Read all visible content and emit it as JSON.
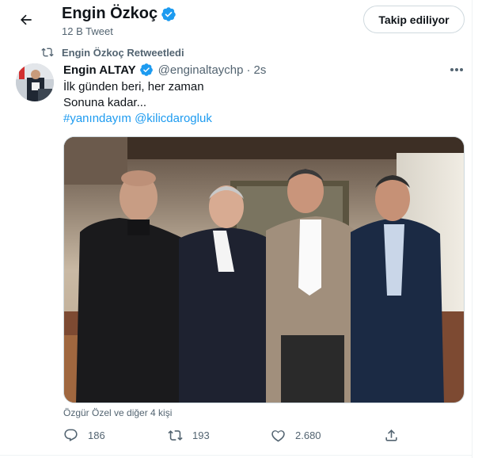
{
  "header": {
    "name": "Engin Özkoç",
    "tweet_count": "12 B Tweet",
    "follow_label": "Takip ediliyor"
  },
  "retweet_context": {
    "text": "Engin Özkoç Retweetledi"
  },
  "tweet": {
    "author_name": "Engin ALTAY",
    "handle": "@enginaltaychp",
    "separator": "·",
    "time": "2s",
    "line1": "İlk günden beri, her zaman",
    "line2": "Sonuna kadar...",
    "hashtag": "#yanındayım",
    "mention": "@kilicdarogluk",
    "likers": "Özgür Özel ve diğer 4 kişi",
    "stats": {
      "replies": "186",
      "retweets": "193",
      "likes": "2.680"
    }
  },
  "colors": {
    "accent": "#1d9bf0",
    "secondary_text": "#536471",
    "primary_text": "#0f1419"
  },
  "icons": {
    "back": "arrow-left-icon",
    "verified": "verified-badge-icon",
    "retweet_context": "retweet-icon",
    "more": "more-horizontal-icon",
    "reply": "reply-icon",
    "retweet": "retweet-icon",
    "like": "heart-icon",
    "share": "share-icon"
  }
}
